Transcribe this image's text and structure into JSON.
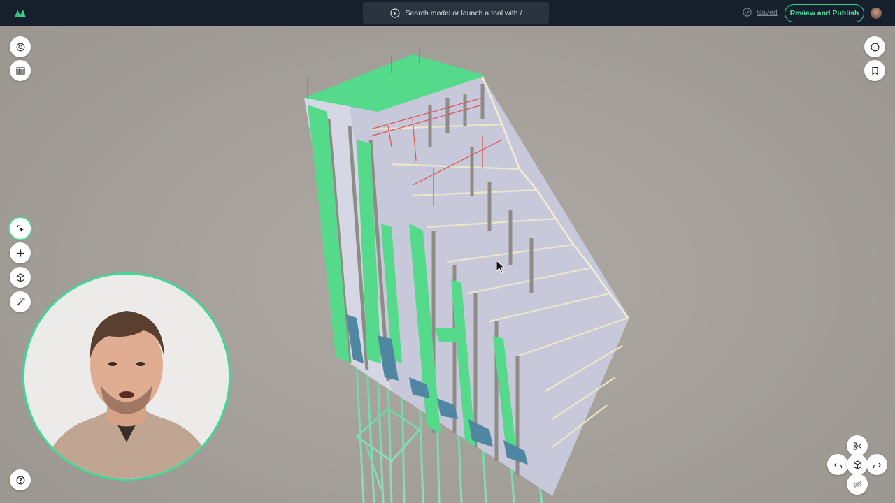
{
  "header": {
    "search": {
      "placeholder": "Search model or launch a tool with /"
    },
    "status": {
      "label": "Saved"
    },
    "publish_button": {
      "label": "Review and Publish"
    }
  },
  "colors": {
    "accent": "#3ccf8b",
    "topbar": "#15202c",
    "slab_green": "#55d98a",
    "slab_gray": "#c6c8d8",
    "rebar_red": "#e0504e"
  },
  "icons": {
    "logo": "app-logo-icon",
    "search": "play-circle-icon",
    "saved": "check-circle-icon",
    "left_top": [
      "search-icon",
      "table-icon"
    ],
    "left_tools": [
      "select-cursor-icon",
      "plus-icon",
      "box-cube-icon",
      "magic-wand-icon"
    ],
    "left_bottom": [
      "help-icon"
    ],
    "right_top": [
      "info-icon",
      "bookmark-icon"
    ],
    "nav_cube": [
      "scissors-icon",
      "undo-icon",
      "cube-icon",
      "redo-icon",
      "eye-off-icon"
    ]
  }
}
